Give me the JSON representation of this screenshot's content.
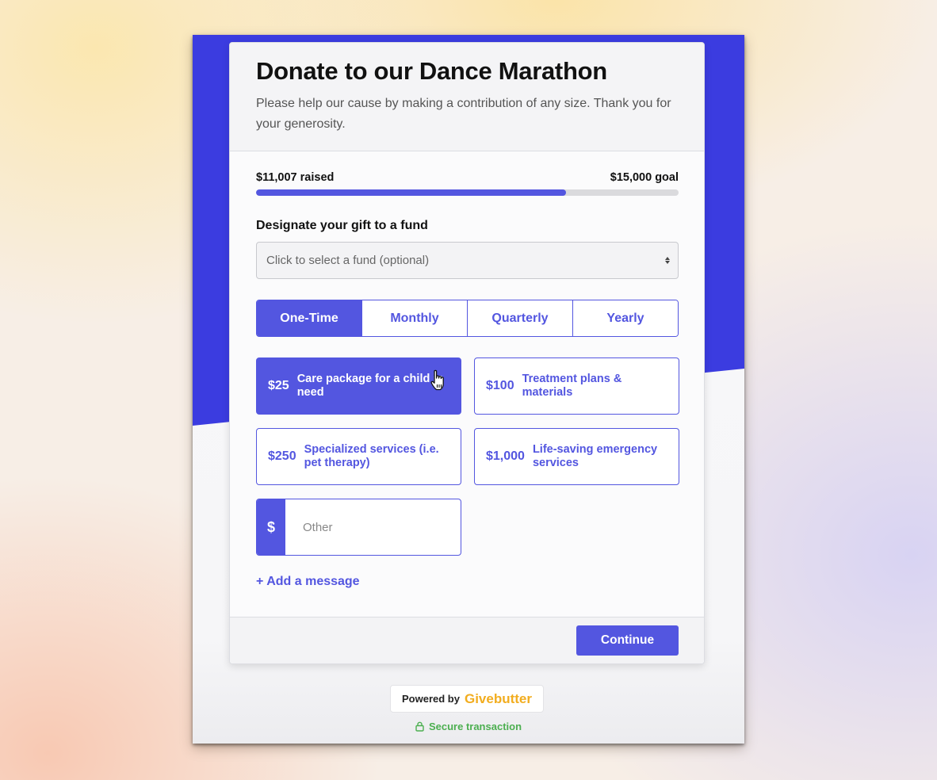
{
  "form": {
    "title": "Donate to our Dance Marathon",
    "subtitle": "Please help our cause by making a contribution of any size. Thank you for your generosity."
  },
  "progress": {
    "raised_label": "$11,007 raised",
    "goal_label": "$15,000 goal",
    "raised": 11007,
    "goal": 15000,
    "fraction": 0.7338
  },
  "fund": {
    "label": "Designate your gift to a fund",
    "placeholder": "Click to select a fund (optional)"
  },
  "frequency": {
    "options": [
      {
        "label": "One-Time",
        "selected": true
      },
      {
        "label": "Monthly",
        "selected": false
      },
      {
        "label": "Quarterly",
        "selected": false
      },
      {
        "label": "Yearly",
        "selected": false
      }
    ]
  },
  "amounts": [
    {
      "value": "$25",
      "description": "Care package for a child in need",
      "selected": true
    },
    {
      "value": "$100",
      "description": "Treatment plans & materials",
      "selected": false
    },
    {
      "value": "$250",
      "description": "Specialized services (i.e. pet therapy)",
      "selected": false
    },
    {
      "value": "$1,000",
      "description": "Life-saving emergency services",
      "selected": false
    }
  ],
  "other_amount": {
    "prefix": "$",
    "placeholder": "Other"
  },
  "add_message_label": "+ Add a message",
  "continue_label": "Continue",
  "footer": {
    "powered_by": "Powered by",
    "brand": "Givebutter",
    "secure_label": "Secure transaction"
  },
  "colors": {
    "accent": "#5356e0",
    "backdrop_blue": "#3b3ce0",
    "brand_yellow": "#f2ad1f",
    "secure_green": "#4caf50"
  }
}
